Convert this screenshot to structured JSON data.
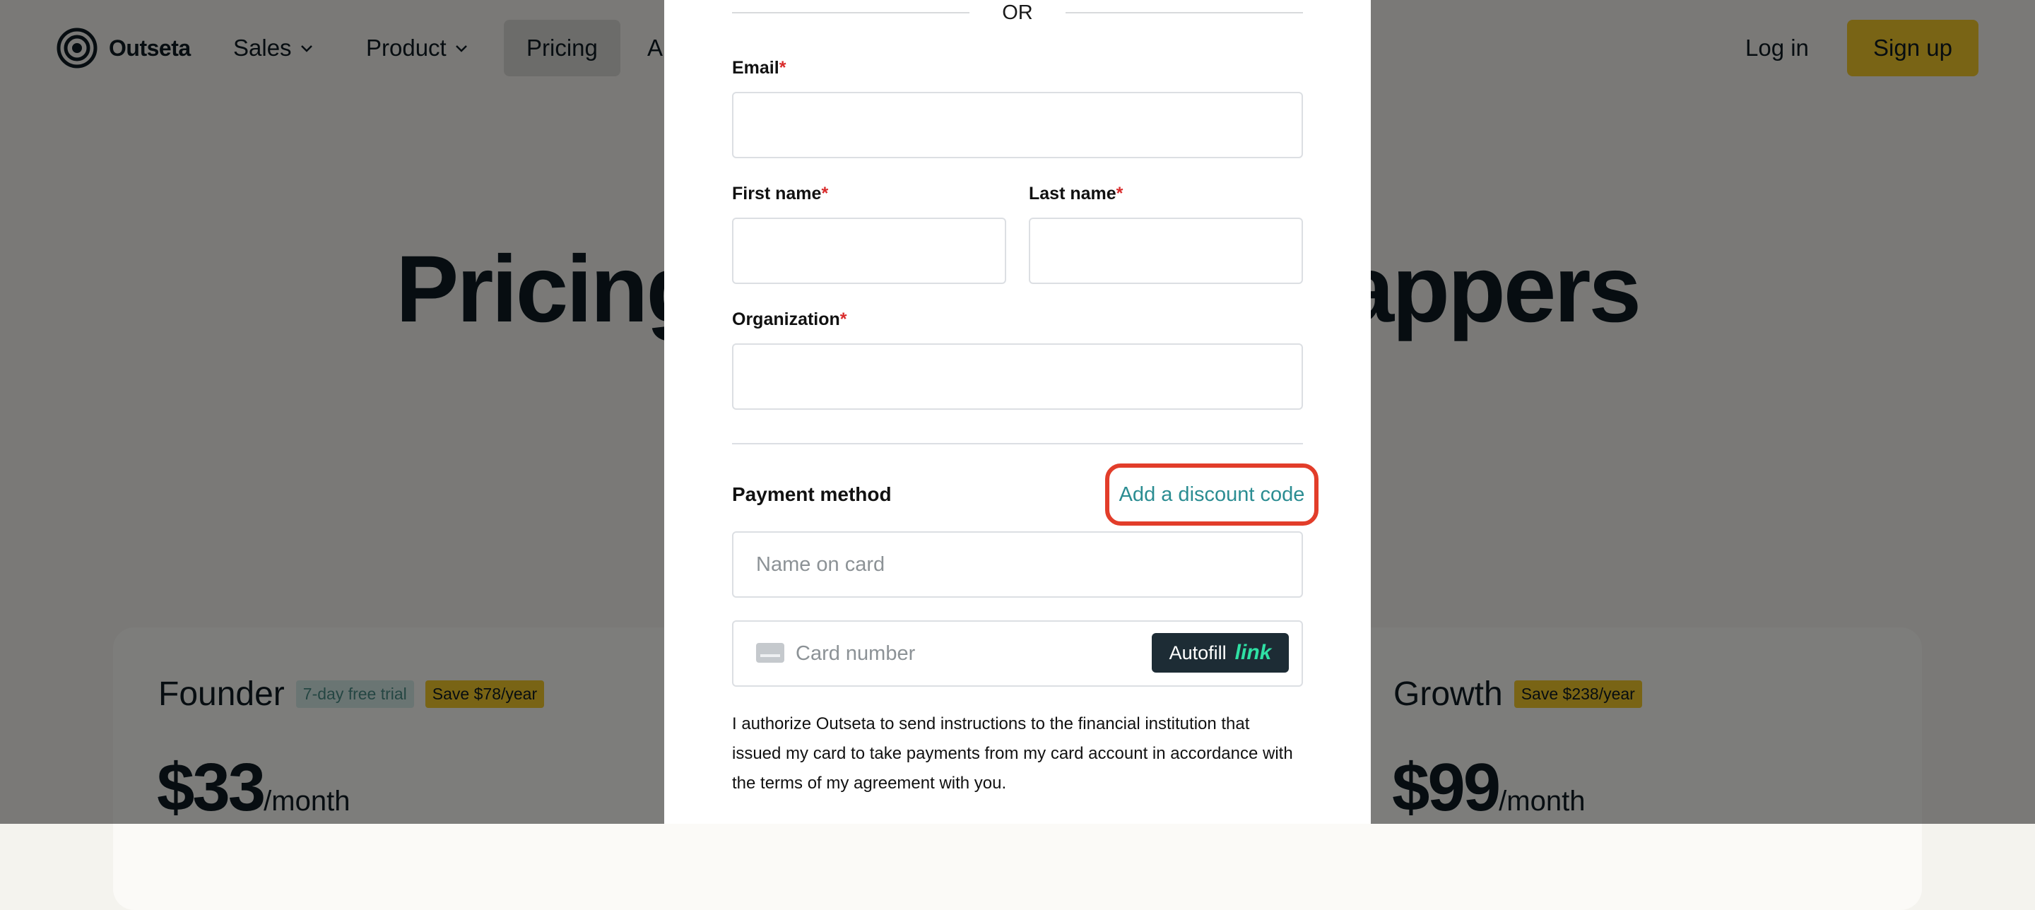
{
  "nav": {
    "brand": "Outseta",
    "items": [
      {
        "label": "Sales",
        "has_dropdown": true
      },
      {
        "label": "Product",
        "has_dropdown": true
      },
      {
        "label": "Pricing",
        "active": true
      },
      {
        "label": "A"
      }
    ],
    "login_label": "Log in",
    "signup_label": "Sign up"
  },
  "hero": {
    "title_left": "Pricing d",
    "title_right": "strappers"
  },
  "plans": [
    {
      "name": "Founder",
      "trial_badge": "7-day free trial",
      "save_badge": "Save $78/year",
      "price": "$33",
      "period": "/month"
    },
    {
      "name": "Growth",
      "save_badge": "Save $238/year",
      "price": "$99",
      "period": "/month"
    }
  ],
  "modal": {
    "or_text": "OR",
    "fields": {
      "email": {
        "label": "Email",
        "required_mark": "*",
        "value": ""
      },
      "first_name": {
        "label": "First name",
        "required_mark": "*",
        "value": ""
      },
      "last_name": {
        "label": "Last name",
        "required_mark": "*",
        "value": ""
      },
      "organization": {
        "label": "Organization",
        "required_mark": "*",
        "value": ""
      }
    },
    "payment": {
      "label": "Payment method",
      "discount_link": "Add a discount code",
      "name_on_card_placeholder": "Name on card",
      "card_number_placeholder": "Card number",
      "autofill_label": "Autofill",
      "autofill_brand": "link"
    },
    "authorization_text": "I authorize Outseta to send instructions to the financial institution that issued my card to take payments from my card account in accordance with the terms of my agreement with you."
  },
  "colors": {
    "accent_yellow": "#f2c82a",
    "link_teal": "#2b8d92",
    "highlight_red": "#e23d2a",
    "overlay": "rgba(0,0,0,0.5)"
  },
  "icons": {
    "logo": "concentric-circles-logo-icon",
    "dropdown": "chevron-down-icon",
    "card": "credit-card-icon"
  }
}
